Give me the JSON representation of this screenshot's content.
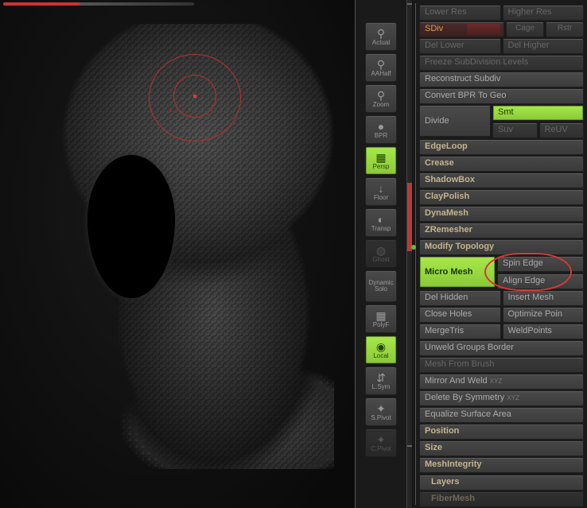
{
  "shelf": [
    {
      "id": "actual",
      "label": "Actual",
      "glyph": "⚲",
      "active": false
    },
    {
      "id": "aahalf",
      "label": "AAHalf",
      "glyph": "⚲",
      "active": false
    },
    {
      "id": "zoom",
      "label": "Zoom",
      "glyph": "⚲",
      "active": false
    },
    {
      "id": "bpr",
      "label": "BPR",
      "glyph": "●",
      "active": false
    },
    {
      "id": "persp",
      "label": "Persp",
      "glyph": "▦",
      "active": true
    },
    {
      "id": "floor",
      "label": "Floor",
      "glyph": "↓",
      "active": false
    },
    {
      "id": "transp",
      "label": "Transp",
      "glyph": "◐",
      "active": false
    },
    {
      "id": "ghost",
      "label": "Ghost",
      "glyph": "◍",
      "active": false,
      "disabled": true
    },
    {
      "id": "dynamic-solo",
      "label": "Solo",
      "sublabel": "Dynamic",
      "glyph": "",
      "active": false
    },
    {
      "id": "polyf",
      "label": "PolyF",
      "glyph": "▦",
      "active": false
    },
    {
      "id": "local",
      "label": "Local",
      "glyph": "◉",
      "active": true
    },
    {
      "id": "lsym",
      "label": "L.Sym",
      "glyph": "⇵",
      "active": false
    },
    {
      "id": "spivot",
      "label": "S.Pivot",
      "glyph": "✦",
      "active": false
    },
    {
      "id": "cpivot",
      "label": "C.Pivot",
      "glyph": "✦",
      "active": false,
      "disabled": true
    }
  ],
  "geometry": {
    "lower_res": "Lower Res",
    "higher_res": "Higher Res",
    "sdiv": "SDiv",
    "cage": "Cage",
    "rstr": "Rstr",
    "del_lower": "Del Lower",
    "del_higher": "Del Higher",
    "freeze": "Freeze SubDivision Levels",
    "reconstruct": "Reconstruct Subdiv",
    "convert_bpr": "Convert BPR To Geo",
    "divide": "Divide",
    "smt": "Smt",
    "suv": "Suv",
    "reuv": "ReUV"
  },
  "sections": {
    "edgeloop": "EdgeLoop",
    "crease": "Crease",
    "shadowbox": "ShadowBox",
    "claypolish": "ClayPolish",
    "dynamesh": "DynaMesh",
    "zremesher": "ZRemesher",
    "modify_topology": "Modify Topology",
    "position": "Position",
    "size": "Size",
    "meshintegrity": "MeshIntegrity",
    "layers": "Layers",
    "fibermesh": "FiberMesh"
  },
  "modify": {
    "micro_mesh": "Micro Mesh",
    "spin_edge": "Spin Edge",
    "align_edge": "Align Edge",
    "del_hidden": "Del Hidden",
    "insert_mesh": "Insert Mesh",
    "close_holes": "Close Holes",
    "optimize_points": "Optimize Poin",
    "mergetris": "MergeTris",
    "weldpoints": "WeldPoints",
    "unweld_groups": "Unweld Groups Border",
    "mesh_from_brush": "Mesh From Brush",
    "mirror_weld": "Mirror And Weld",
    "delete_by_sym": "Delete By Symmetry",
    "equalize": "Equalize Surface Area"
  },
  "corner_marks": {
    "xyz": "X Y Z"
  }
}
